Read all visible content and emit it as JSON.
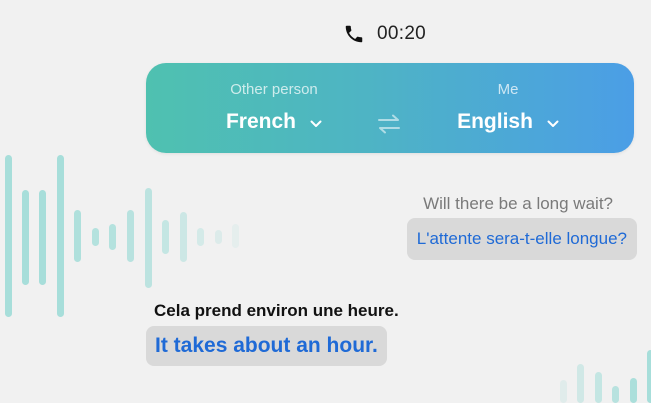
{
  "call": {
    "icon": "phone-icon",
    "duration": "00:20"
  },
  "languages": {
    "other_person": {
      "role": "Other person",
      "language": "French"
    },
    "me": {
      "role": "Me",
      "language": "English"
    },
    "swap_icon": "swap-arrows-icon"
  },
  "conversation": [
    {
      "speaker": "other_person",
      "original": "Will there be a long wait?",
      "translation": "L'attente sera-t-elle longue?"
    },
    {
      "speaker": "me",
      "original": "Cela prend environ une heure.",
      "translation": "It takes about an hour."
    }
  ],
  "colors": {
    "gradient_start": "#4fc1b0",
    "gradient_end": "#4b9ee6",
    "translation_text": "#1f6ad6",
    "bubble_bg": "#d9d9d9",
    "waveform": "#9fdcd7"
  }
}
